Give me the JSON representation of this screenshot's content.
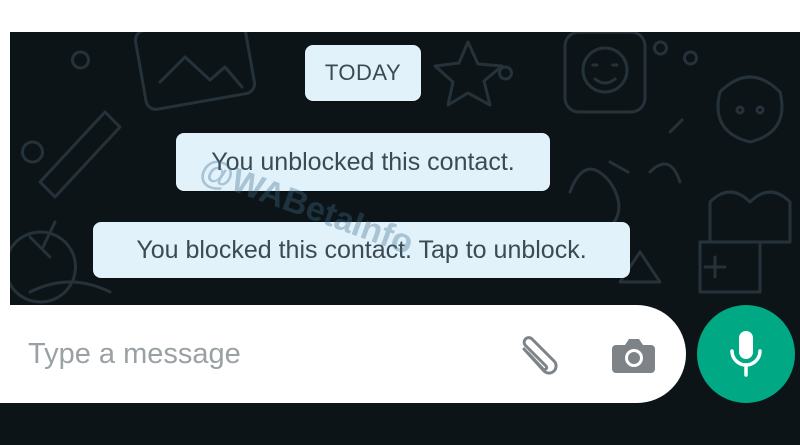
{
  "chat": {
    "date_chip": "TODAY",
    "system_messages": [
      "You unblocked this contact.",
      "You blocked this contact. Tap to unblock."
    ],
    "watermark": "@WABetaInfo"
  },
  "composer": {
    "placeholder": "Type a message",
    "icons": [
      "paperclip-icon",
      "camera-icon",
      "microphone-icon"
    ]
  },
  "colors": {
    "chat_background": "#0d1418",
    "system_bubble": "#e1f2fb",
    "mic_button": "#00a884"
  }
}
